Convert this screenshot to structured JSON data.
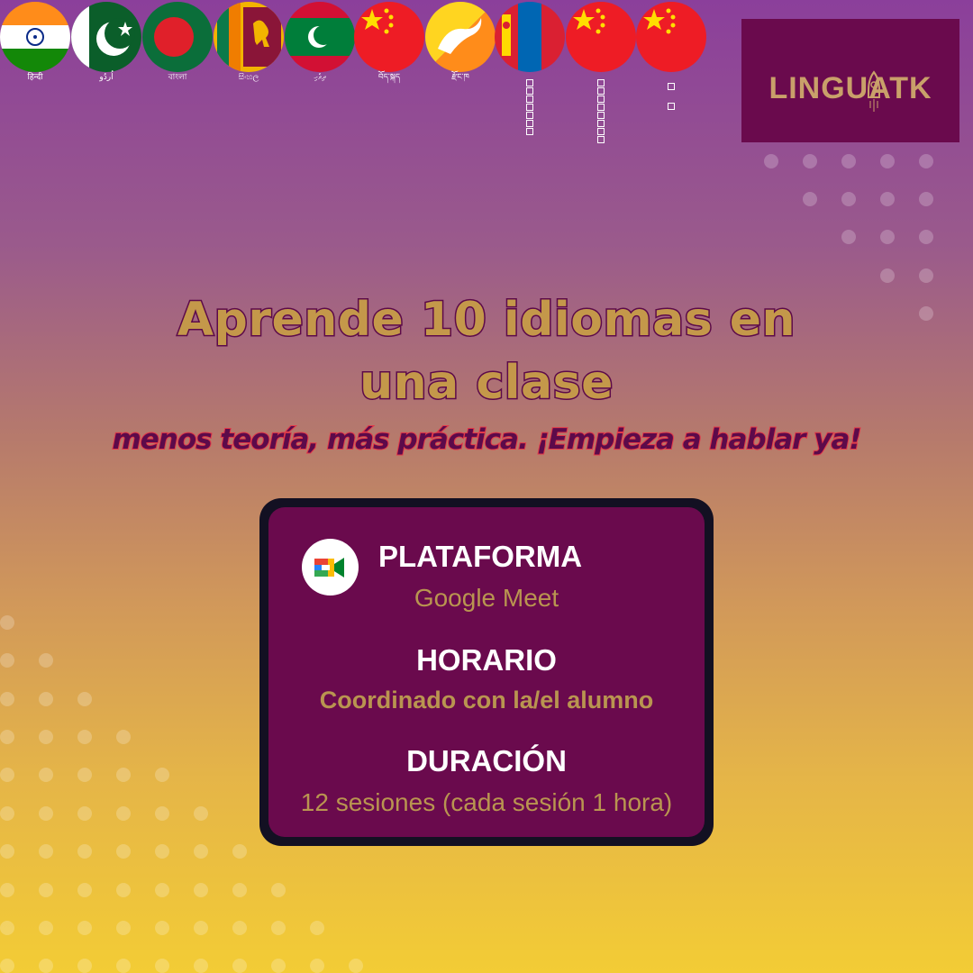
{
  "flags": [
    {
      "country": "india",
      "label": "हिन्दी"
    },
    {
      "country": "pakistan",
      "label": "اُردُو"
    },
    {
      "country": "bangladesh",
      "label": "বাংলা"
    },
    {
      "country": "sri-lanka",
      "label": "සිංහල"
    },
    {
      "country": "maldives",
      "label": "ދިވެހި"
    },
    {
      "country": "china",
      "label": "བོད་སྐད"
    },
    {
      "country": "bhutan",
      "label": "རྫོང་ཁ"
    },
    {
      "country": "mongolia",
      "label": ""
    },
    {
      "country": "china",
      "label": ""
    },
    {
      "country": "china",
      "label": ""
    }
  ],
  "logo": {
    "text": "LINGUATK",
    "icon": "rocket-icon"
  },
  "headline": {
    "line1": "Aprende 10 idiomas en",
    "line2": "una clase"
  },
  "subheadline": "menos teoría, más práctica. ¡Empieza a hablar ya!",
  "info": {
    "platform_title": "PLATAFORMA",
    "platform_value": "Google Meet",
    "platform_icon": "google-meet-icon",
    "schedule_title": "HORARIO",
    "schedule_value": "Coordinado con la/el alumno",
    "duration_title": "DURACIÓN",
    "duration_value": "12 sesiones (cada sesión 1 hora)"
  },
  "colors": {
    "card": "#6a0a4d",
    "accent": "#c4984a",
    "subheadline_outline": "#e33848"
  }
}
